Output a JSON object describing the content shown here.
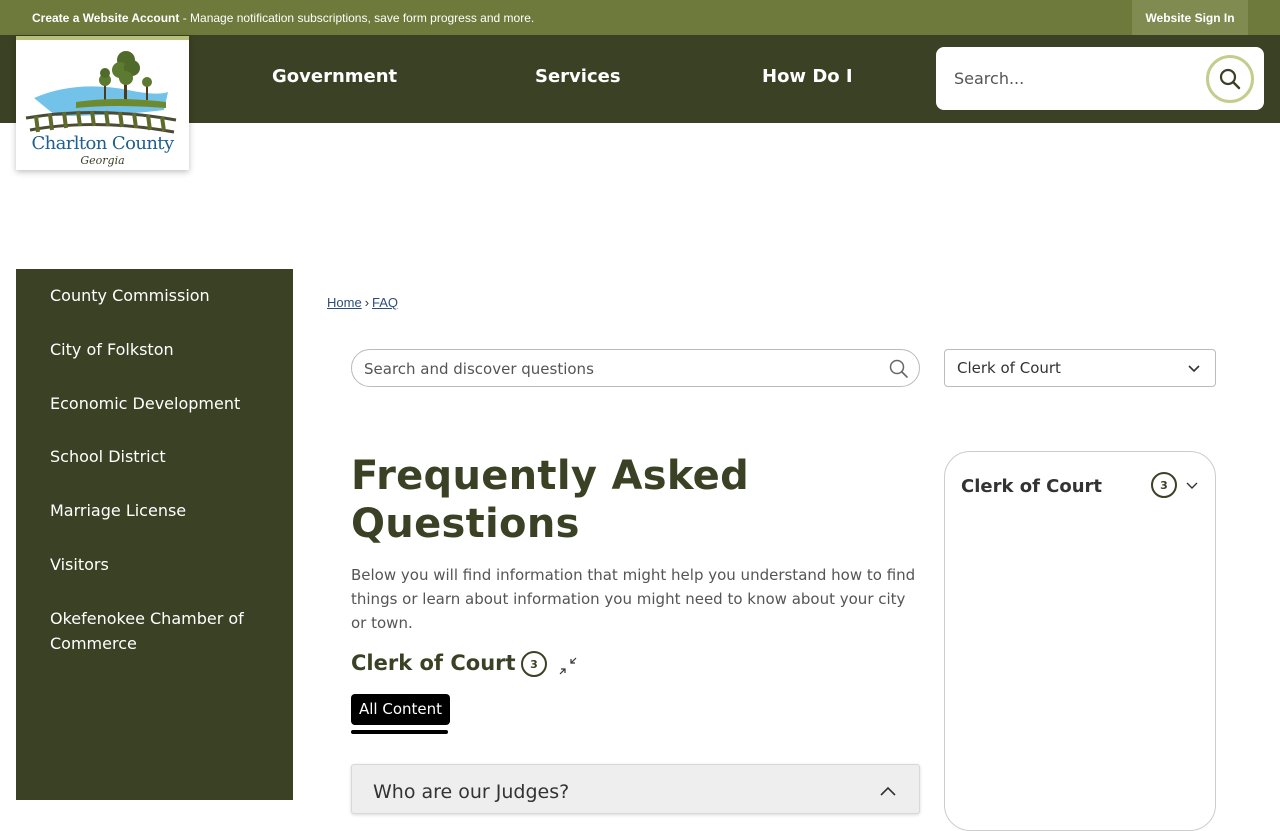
{
  "topbar": {
    "create_account": "Create a Website Account",
    "notice_rest": " - Manage notification subscriptions, save form progress and more.",
    "signin": "Website Sign In"
  },
  "logo": {
    "name": "Charlton County",
    "state": "Georgia"
  },
  "nav": {
    "items": [
      "Government",
      "Services",
      "How Do I"
    ]
  },
  "search": {
    "placeholder": "Search..."
  },
  "sidebar": {
    "items": [
      "County Commission",
      "City of Folkston",
      "Economic Development",
      "School District",
      "Marriage License",
      "Visitors",
      "Okefenokee Chamber of Commerce"
    ]
  },
  "breadcrumb": {
    "home": "Home",
    "separator": "›",
    "current": "FAQ"
  },
  "faq": {
    "search_placeholder": "Search and discover questions",
    "category_selected": "Clerk of Court",
    "title": "Frequently Asked Questions",
    "intro": "Below you will find information that might help you understand how to find things or learn about information you might need to know about your city or town.",
    "section_title": "Clerk of Court",
    "section_count": "3",
    "tab_all": "All Content",
    "questions": [
      "Who are our Judges?"
    ]
  },
  "category_panel": {
    "label": "Clerk of Court",
    "count": "3"
  },
  "colors": {
    "topbar": "#6d7a3b",
    "header": "#3b4124",
    "accent": "#c4cc8e",
    "link": "#2c4d7a"
  }
}
